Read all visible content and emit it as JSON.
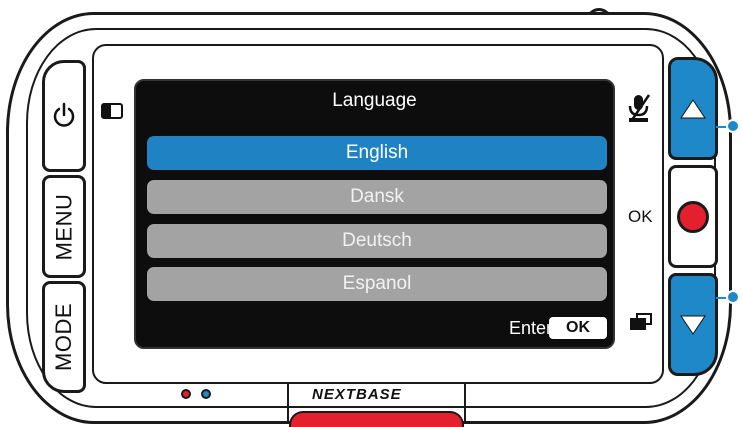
{
  "device": {
    "brand": "NEXTBASE",
    "left_buttons": {
      "menu_label": "MENU",
      "mode_label": "MODE",
      "power_icon": "power-icon"
    },
    "right_buttons": {
      "up_icon": "triangle-up-icon",
      "down_icon": "triangle-down-icon",
      "record_icon": "record-dot-icon",
      "ok_label": "OK"
    },
    "side_icons": {
      "top_left": "screen-toggle-icon",
      "top_right": "mic-muted-icon",
      "bottom_right": "protect-file-icon"
    },
    "leds": [
      "#e5202e",
      "#1f88c9"
    ]
  },
  "screen": {
    "title": "Language",
    "items": [
      {
        "label": "English",
        "selected": true
      },
      {
        "label": "Dansk",
        "selected": false
      },
      {
        "label": "Deutsch",
        "selected": false
      },
      {
        "label": "Espanol",
        "selected": false
      }
    ],
    "footer": {
      "enter_label": "Enter",
      "ok_key": "OK"
    }
  },
  "colors": {
    "accent": "#1f82c3",
    "unselected": "#a3a3a3",
    "record": "#e5202e",
    "screen_bg": "#0d0d0d"
  }
}
